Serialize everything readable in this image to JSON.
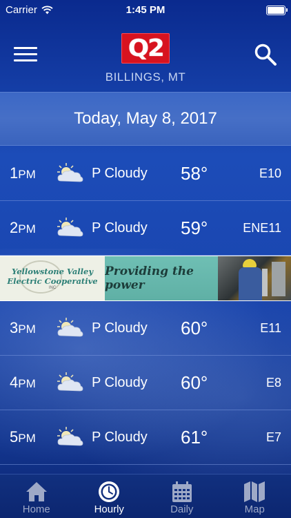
{
  "status_bar": {
    "carrier": "Carrier",
    "time": "1:45 PM"
  },
  "header": {
    "location": "BILLINGS, MT",
    "logo_text": "Q2"
  },
  "date_label": "Today, May 8, 2017",
  "hours_before_ad": [
    {
      "hour": "1",
      "period": "PM",
      "icon": "partly-cloudy-icon",
      "condition": "P Cloudy",
      "temp": "58°",
      "wind": "E10"
    },
    {
      "hour": "2",
      "period": "PM",
      "icon": "partly-cloudy-icon",
      "condition": "P Cloudy",
      "temp": "59°",
      "wind": "ENE11"
    }
  ],
  "ad": {
    "line1": "Yellowstone Valley",
    "line2": "Electric Cooperative",
    "line3": "INC",
    "tagline": "Providing the power"
  },
  "hours_after_ad": [
    {
      "hour": "3",
      "period": "PM",
      "icon": "partly-cloudy-icon",
      "condition": "P Cloudy",
      "temp": "60°",
      "wind": "E11"
    },
    {
      "hour": "4",
      "period": "PM",
      "icon": "partly-cloudy-icon",
      "condition": "P Cloudy",
      "temp": "60°",
      "wind": "E8"
    },
    {
      "hour": "5",
      "period": "PM",
      "icon": "partly-cloudy-icon",
      "condition": "P Cloudy",
      "temp": "61°",
      "wind": "E7"
    }
  ],
  "tabs": [
    {
      "label": "Home",
      "icon": "home-icon",
      "active": false
    },
    {
      "label": "Hourly",
      "icon": "clock-icon",
      "active": true
    },
    {
      "label": "Daily",
      "icon": "calendar-icon",
      "active": false
    },
    {
      "label": "Map",
      "icon": "map-icon",
      "active": false
    }
  ],
  "colors": {
    "logo_red": "#d7131f",
    "background_blue": "#1c4cb8",
    "tab_inactive": "#9ea9c7"
  }
}
